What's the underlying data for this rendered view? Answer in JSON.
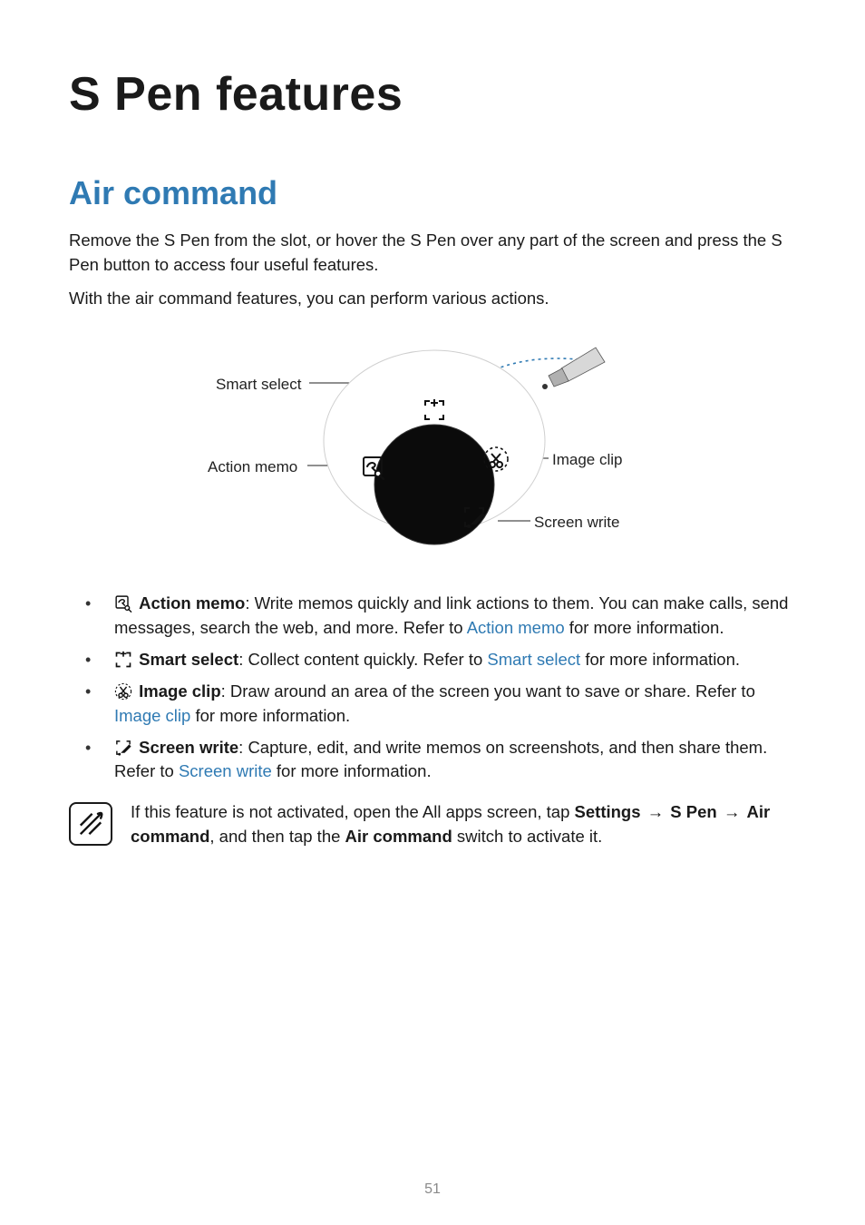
{
  "page": {
    "title": "S Pen features",
    "number": "51"
  },
  "section": {
    "heading": "Air command",
    "intro1": "Remove the S Pen from the slot, or hover the S Pen over any part of the screen and press the S Pen button to access four useful features.",
    "intro2": "With the air command features, you can perform various actions."
  },
  "diagram": {
    "smart_select": "Smart select",
    "action_memo": "Action memo",
    "image_clip": "Image clip",
    "screen_write": "Screen write"
  },
  "features": {
    "action_memo": {
      "label": "Action memo",
      "desc_before_link": ": Write memos quickly and link actions to them. You can make calls, send messages, search the web, and more. Refer to ",
      "link": "Action memo",
      "desc_after_link": " for more information."
    },
    "smart_select": {
      "label": "Smart select",
      "desc_before_link": ": Collect content quickly. Refer to ",
      "link": "Smart select",
      "desc_after_link": " for more information."
    },
    "image_clip": {
      "label": "Image clip",
      "desc_before_link": ": Draw around an area of the screen you want to save or share. Refer to ",
      "link": "Image clip",
      "desc_after_link": " for more information."
    },
    "screen_write": {
      "label": "Screen write",
      "desc_before_link": ": Capture, edit, and write memos on screenshots, and then share them. Refer to ",
      "link": "Screen write",
      "desc_after_link": " for more information."
    }
  },
  "note": {
    "t1": "If this feature is not activated, open the All apps screen, tap ",
    "settings": "Settings",
    "arrow": "→",
    "spen": "S Pen",
    "air_cmd_bold": "Air command",
    "t2": ", and then tap the ",
    "air_cmd_bold2": "Air command",
    "t3": " switch to activate it."
  }
}
